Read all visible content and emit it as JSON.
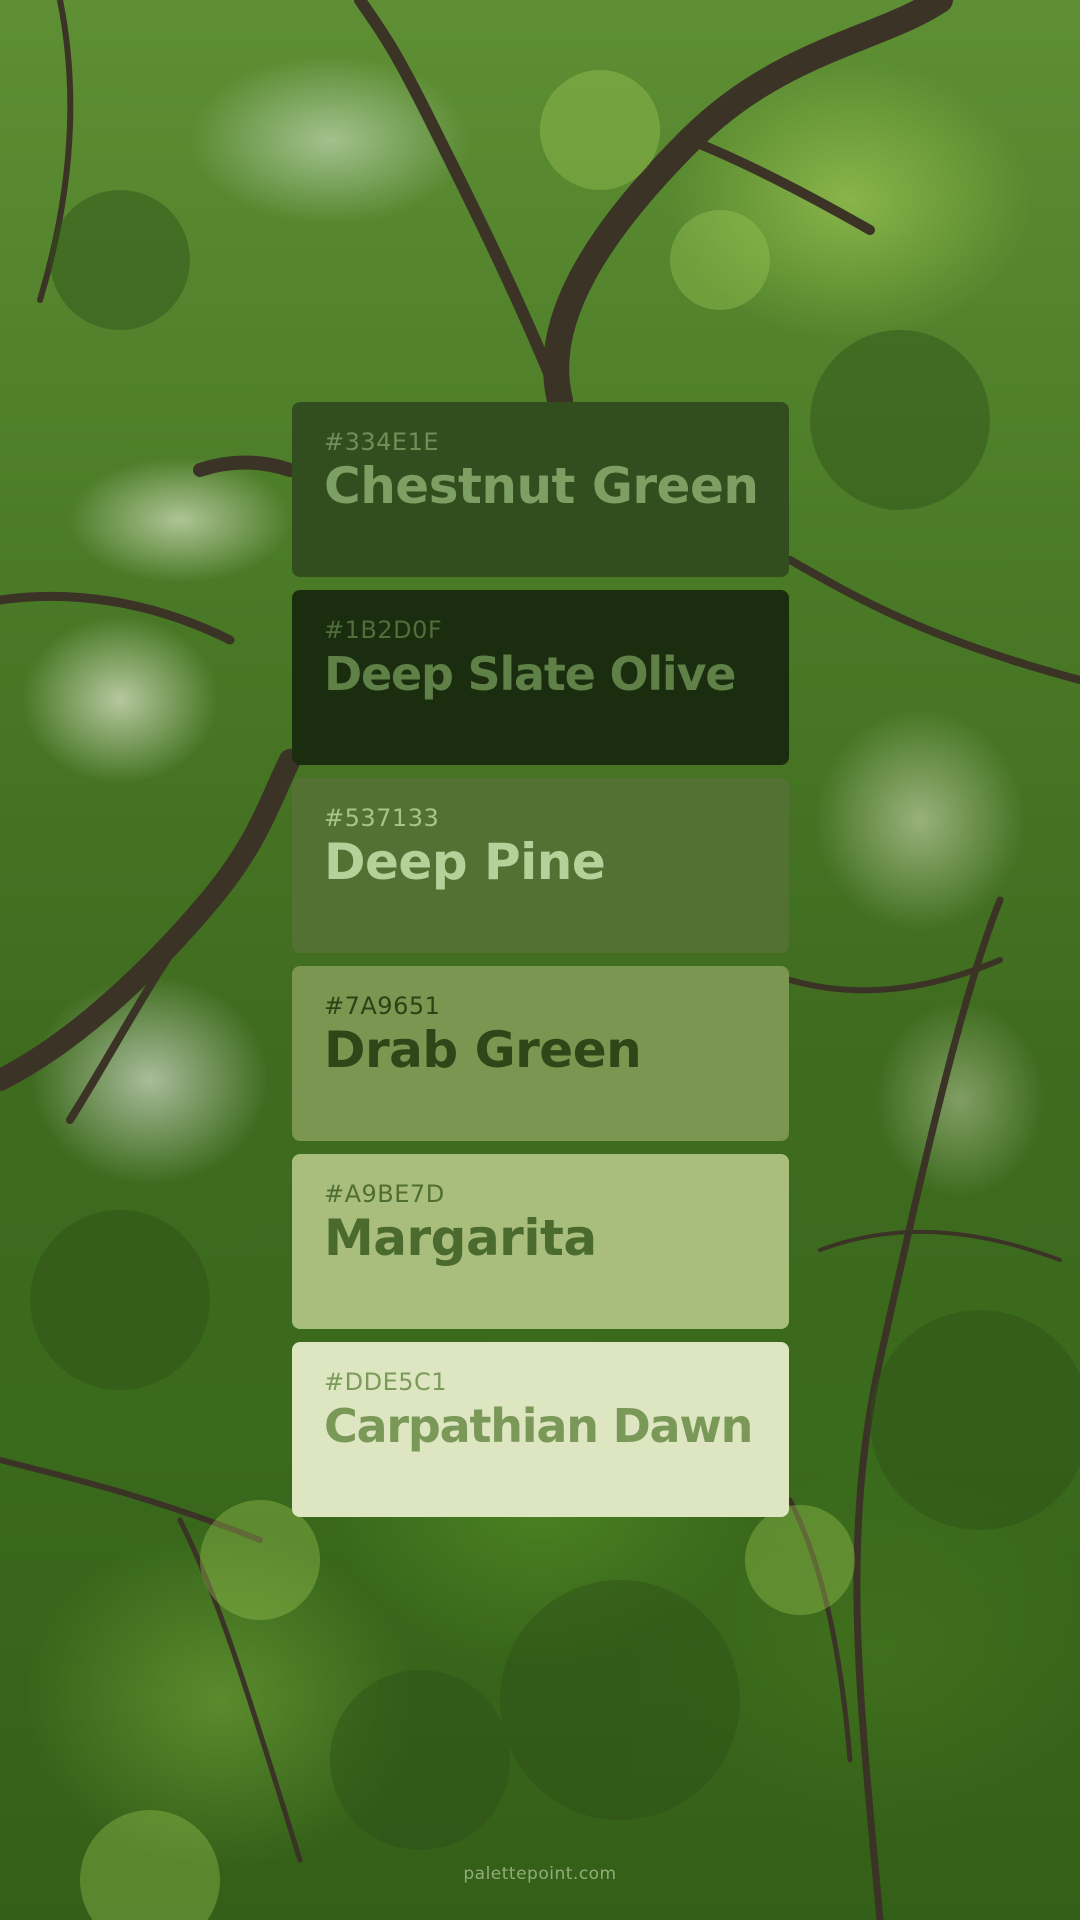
{
  "palette": {
    "swatches": [
      {
        "hex": "#334E1E",
        "name": "Chestnut Green",
        "bg": "#334E1E",
        "hex_color": "#6F8F57",
        "name_color": "#7E9F63"
      },
      {
        "hex": "#1B2D0F",
        "name": "Deep Slate Olive",
        "bg": "#1B2D0F",
        "hex_color": "#506E3B",
        "name_color": "#5F8046"
      },
      {
        "hex": "#537133",
        "name": "Deep Pine",
        "bg": "#537133",
        "hex_color": "#A8C48B",
        "name_color": "#B6D09A"
      },
      {
        "hex": "#7A9651",
        "name": "Drab Green",
        "bg": "#7A9651",
        "hex_color": "#2A4315",
        "name_color": "#2D4718"
      },
      {
        "hex": "#A9BE7D",
        "name": "Margarita",
        "bg": "#A9BE7D",
        "hex_color": "#4F6E33",
        "name_color": "#4A6A2E"
      },
      {
        "hex": "#DDE5C1",
        "name": "Carpathian Dawn",
        "bg": "#DDE5C1",
        "hex_color": "#7C9A5A",
        "name_color": "#7A9858"
      }
    ]
  },
  "footer": {
    "watermark": "palettepoint.com"
  }
}
